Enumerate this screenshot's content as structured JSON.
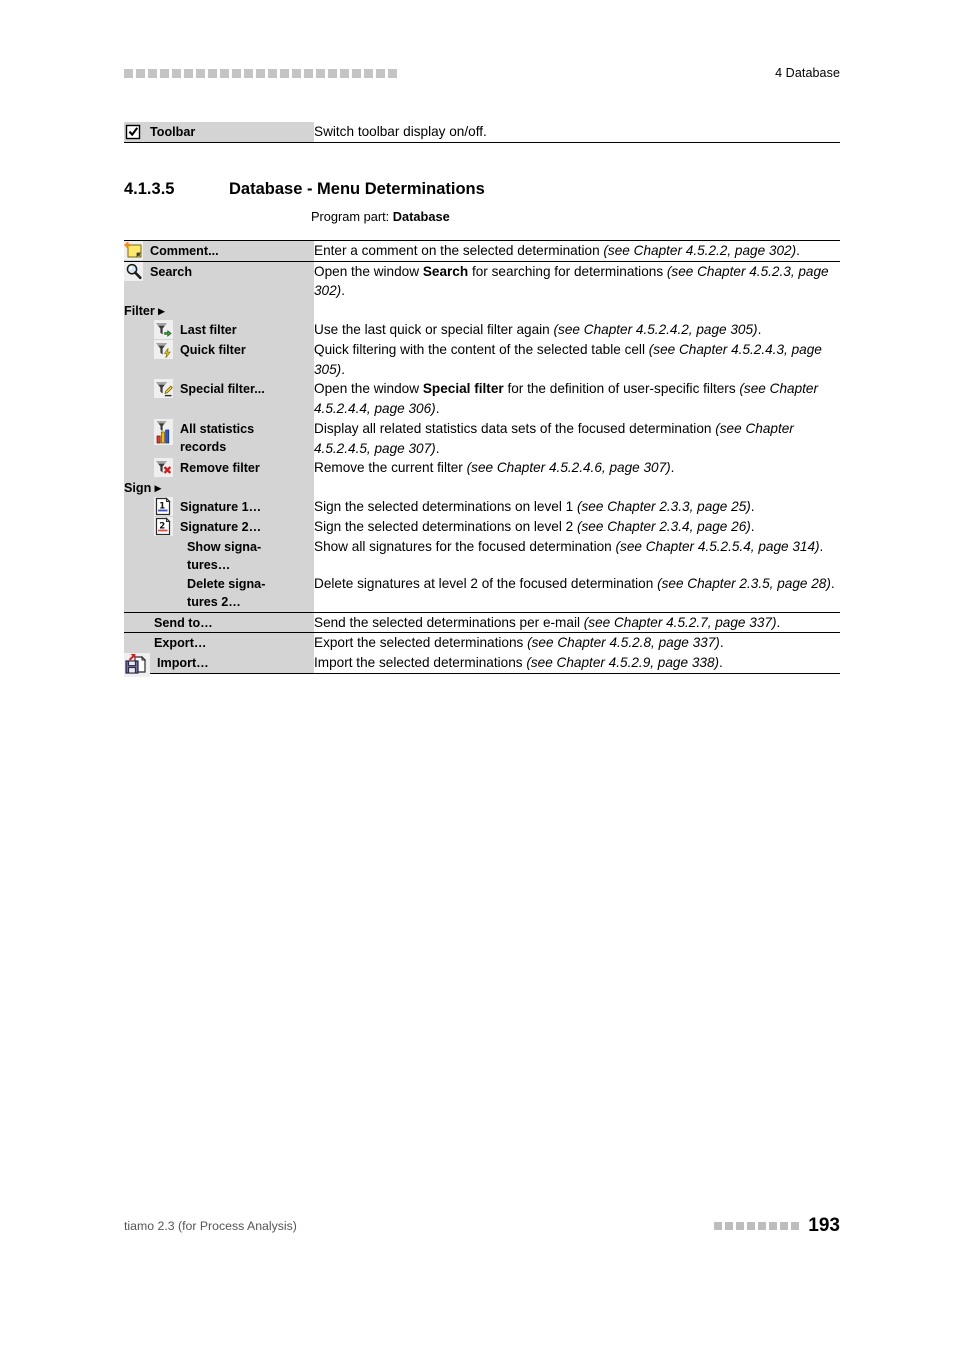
{
  "header": {
    "decor_squares": 23,
    "title": "4 Database"
  },
  "top_table": {
    "rows": [
      {
        "icon": "checkbox-checked-icon",
        "label": "Toolbar",
        "desc_html": "Switch toolbar display on/off."
      }
    ]
  },
  "section": {
    "number": "4.1.3.5",
    "title": "Database - Menu Determinations",
    "subtitle_prefix": "Program part: ",
    "subtitle_bold": "Database"
  },
  "main_table": {
    "rows": [
      {
        "icon": "comment-add-icon",
        "indent": "icon",
        "label": "Comment...",
        "desc_html": "Enter a comment on the selected determination <em>(see Chapter 4.5.2.2, page 302)</em>."
      },
      {
        "icon": "search-magnifier-icon",
        "indent": "icon",
        "label": "Search",
        "desc_html": "Open the window <b>Search</b> for searching for determinations <em>(see Chapter 4.5.2.3, page 302)</em>."
      },
      {
        "icon": "none",
        "indent": "submenu",
        "label": "Filter ▸",
        "desc_html": ""
      },
      {
        "icon": "filter-last-icon",
        "indent": "icon-sub",
        "label": "Last filter",
        "desc_html": "Use the last quick or special filter again <em>(see Chapter 4.5.2.4.2, page 305)</em>."
      },
      {
        "icon": "filter-quick-icon",
        "indent": "icon-sub",
        "label": "Quick filter",
        "desc_html": "Quick filtering with the content of the selected table cell <em>(see Chapter 4.5.2.4.3, page 305)</em>."
      },
      {
        "icon": "filter-special-icon",
        "indent": "icon-sub",
        "label": "Special filter...",
        "desc_html": "Open the window <b>Special filter</b> for the definition of user-specific filters <em>(see Chapter 4.5.2.4.4, page 306)</em>."
      },
      {
        "icon": "filter-statistics-icon",
        "indent": "icon-sub",
        "label": "All statistics records",
        "desc_html": "Display all related statistics data sets of the focused determination <em>(see Chapter 4.5.2.4.5, page 307)</em>."
      },
      {
        "icon": "filter-remove-icon",
        "indent": "icon-sub",
        "label": "Remove filter",
        "desc_html": "Remove the current filter <em>(see Chapter 4.5.2.4.6, page 307)</em>."
      },
      {
        "icon": "none",
        "indent": "submenu",
        "label": "Sign ▸",
        "desc_html": ""
      },
      {
        "icon": "signature-1-icon",
        "indent": "icon-sub",
        "label": "Signature 1…",
        "desc_html": "Sign the selected determinations on level 1 <em>(see Chapter 2.3.3, page 25)</em>."
      },
      {
        "icon": "signature-2-icon",
        "indent": "icon-sub",
        "label": "Signature 2…",
        "desc_html": "Sign the selected determinations on level 2 <em>(see Chapter 2.3.4, page 26)</em>."
      },
      {
        "icon": "none",
        "indent": "text-sub",
        "label": "Show signa-tures…",
        "desc_html": "Show all signatures for the focused determination <em>(see Chapter 4.5.2.5.4, page 314)</em>."
      },
      {
        "icon": "none",
        "indent": "text-sub",
        "label": "Delete signa-tures 2…",
        "desc_html": "Delete signatures at level 2 of the focused determination <em>(see Chapter 2.3.5, page 28)</em>."
      },
      {
        "icon": "none",
        "indent": "text",
        "label": "Send to…",
        "desc_html": "Send the selected determinations per e-mail <em>(see Chapter 4.5.2.7, page 337)</em>."
      },
      {
        "icon": "none",
        "indent": "text",
        "label": "Export…",
        "desc_html": "Export the selected determinations <em>(see Chapter 4.5.2.8, page 337)</em>."
      },
      {
        "icon": "import-icon",
        "indent": "icon",
        "label": "Import…",
        "desc_html": "Import the selected determinations <em>(see Chapter 4.5.2.9, page 338)</em>."
      }
    ]
  },
  "footer": {
    "product": "tiamo 2.3 (for Process Analysis)",
    "decor_squares": 8,
    "page_number": "193"
  },
  "colors": {
    "label_cell_bg": "#d4d4d4",
    "decor_square": "#c4c4c4",
    "rule": "#000000"
  }
}
